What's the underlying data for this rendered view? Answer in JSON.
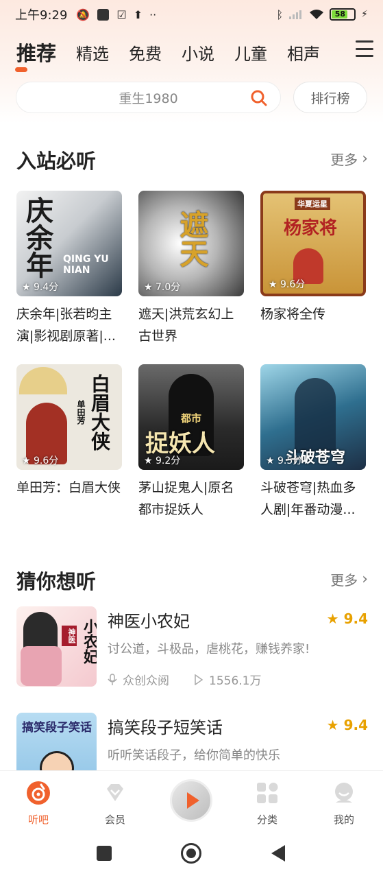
{
  "status": {
    "time": "上午9:29",
    "battery": "58"
  },
  "tabs": [
    {
      "label": "推荐",
      "active": true
    },
    {
      "label": "精选"
    },
    {
      "label": "免费"
    },
    {
      "label": "小说"
    },
    {
      "label": "儿童"
    },
    {
      "label": "相声"
    }
  ],
  "search": {
    "placeholder": "重生1980",
    "rank_label": "排行榜"
  },
  "section1": {
    "title": "入站必听",
    "more": "更多",
    "items": [
      {
        "title": "庆余年|张若昀主演|影视剧原著|...",
        "rating": "9.4分",
        "cover_text": "庆余年",
        "cover_sub": "QING YU NIAN",
        "cover_bg": "#2b3a48"
      },
      {
        "title": "遮天|洪荒玄幻上古世界",
        "rating": "7.0分",
        "cover_text": "遮天",
        "cover_bg": "#8a8a8a"
      },
      {
        "title": "杨家将全传",
        "rating": "9.6分",
        "cover_text": "杨家将",
        "cover_sub": "华夏运星",
        "cover_bg": "#d8b05a"
      },
      {
        "title": "单田芳：白眉大侠",
        "rating": "9.6分",
        "cover_text": "白眉大侠",
        "cover_sub": "单田芳",
        "cover_bg": "#e9e6de"
      },
      {
        "title": "茅山捉鬼人|原名都市捉妖人",
        "rating": "9.2分",
        "cover_text": "捉妖人",
        "cover_sub": "都市",
        "cover_bg": "#3a3a3a"
      },
      {
        "title": "斗破苍穹|热血多人剧|年番动漫...",
        "rating": "9.5分",
        "cover_text": "斗破苍穹",
        "cover_bg": "#2f5c7c"
      }
    ]
  },
  "section2": {
    "title": "猜你想听",
    "more": "更多",
    "items": [
      {
        "title": "神医小农妃",
        "score": "9.4",
        "desc": "讨公道，斗极品，虐桃花，赚钱养家!",
        "author": "众创众阅",
        "plays": "1556.1万",
        "cover_text": "小农妃",
        "cover_tag": "神医"
      },
      {
        "title": "搞笑段子短笑话",
        "score": "9.4",
        "desc": "听听笑话段子，给你简单的快乐",
        "cover_text": "搞笑段子笑话"
      }
    ]
  },
  "bottomnav": [
    {
      "label": "听吧",
      "icon": "listen-icon",
      "active": true
    },
    {
      "label": "会员",
      "icon": "vip-diamond-icon"
    },
    {
      "label": "分类",
      "icon": "category-grid-icon"
    },
    {
      "label": "我的",
      "icon": "profile-icon"
    }
  ],
  "colors": {
    "accent": "#f0612d",
    "star": "#e8a100"
  }
}
